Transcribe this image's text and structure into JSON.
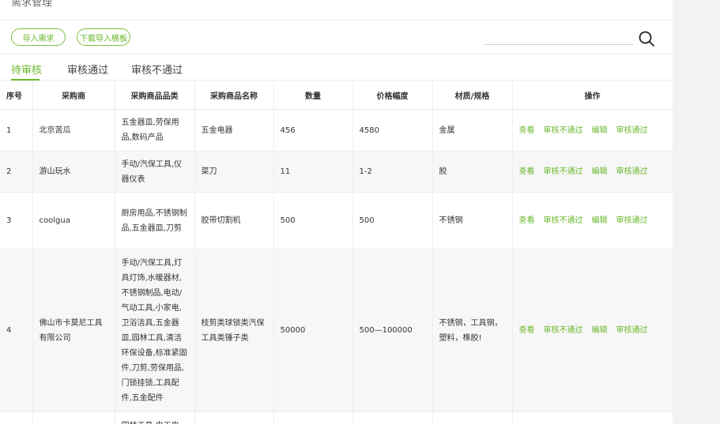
{
  "header": {
    "title": "需求管理"
  },
  "toolbar": {
    "import_label": "导入需求",
    "download_label": "下载导入模板"
  },
  "tabs": [
    {
      "label": "待审核",
      "active": true
    },
    {
      "label": "审核通过",
      "active": false
    },
    {
      "label": "审核不通过",
      "active": false
    }
  ],
  "table": {
    "columns": [
      "序号",
      "采购商",
      "采购商品品类",
      "采购商品名称",
      "数量",
      "价格幅度",
      "材质/规格",
      "操作"
    ],
    "actions": [
      "查看",
      "审核不通过",
      "编辑",
      "审核通过"
    ],
    "rows": [
      {
        "index": "1",
        "buyer": "北京苦瓜",
        "category": "五金器皿,劳保用品,数码产品",
        "product": "五金电器",
        "quantity": "456",
        "price": "4580",
        "material": "金属"
      },
      {
        "index": "2",
        "buyer": "游山玩水",
        "category": "手动/汽保工具,仪器仪表",
        "product": "菜刀",
        "quantity": "11",
        "price": "1-2",
        "material": "胶"
      },
      {
        "index": "3",
        "buyer": "coolgua",
        "category": "厨房用品,不锈钢制品,五金器皿,刀剪",
        "product": "胶带切割机",
        "quantity": "500",
        "price": "500",
        "material": "不锈钢"
      },
      {
        "index": "4",
        "buyer": "佛山市卡莫尼工具有限公司",
        "category": "手动/汽保工具,灯具灯饰,水暖器材,不锈钢制品,电动/气动工具,小家电,卫浴洁具,五金器皿,园林工具,清洁环保设备,标准紧固件,刀剪,劳保用品,门锁挂锁,工具配件,五金配件",
        "product": "枝剪类球锁类汽保工具类锤子类",
        "quantity": "50000",
        "price": "500—100000",
        "material": "不锈钢，工具钢，塑料，橡胶!"
      },
      {
        "index": "",
        "buyer": "",
        "category": "园林工具,电工电",
        "product": "",
        "quantity": "",
        "price": "",
        "material": ""
      }
    ]
  },
  "colors": {
    "accent": "#6ab82c",
    "border": "#eeeeee"
  }
}
